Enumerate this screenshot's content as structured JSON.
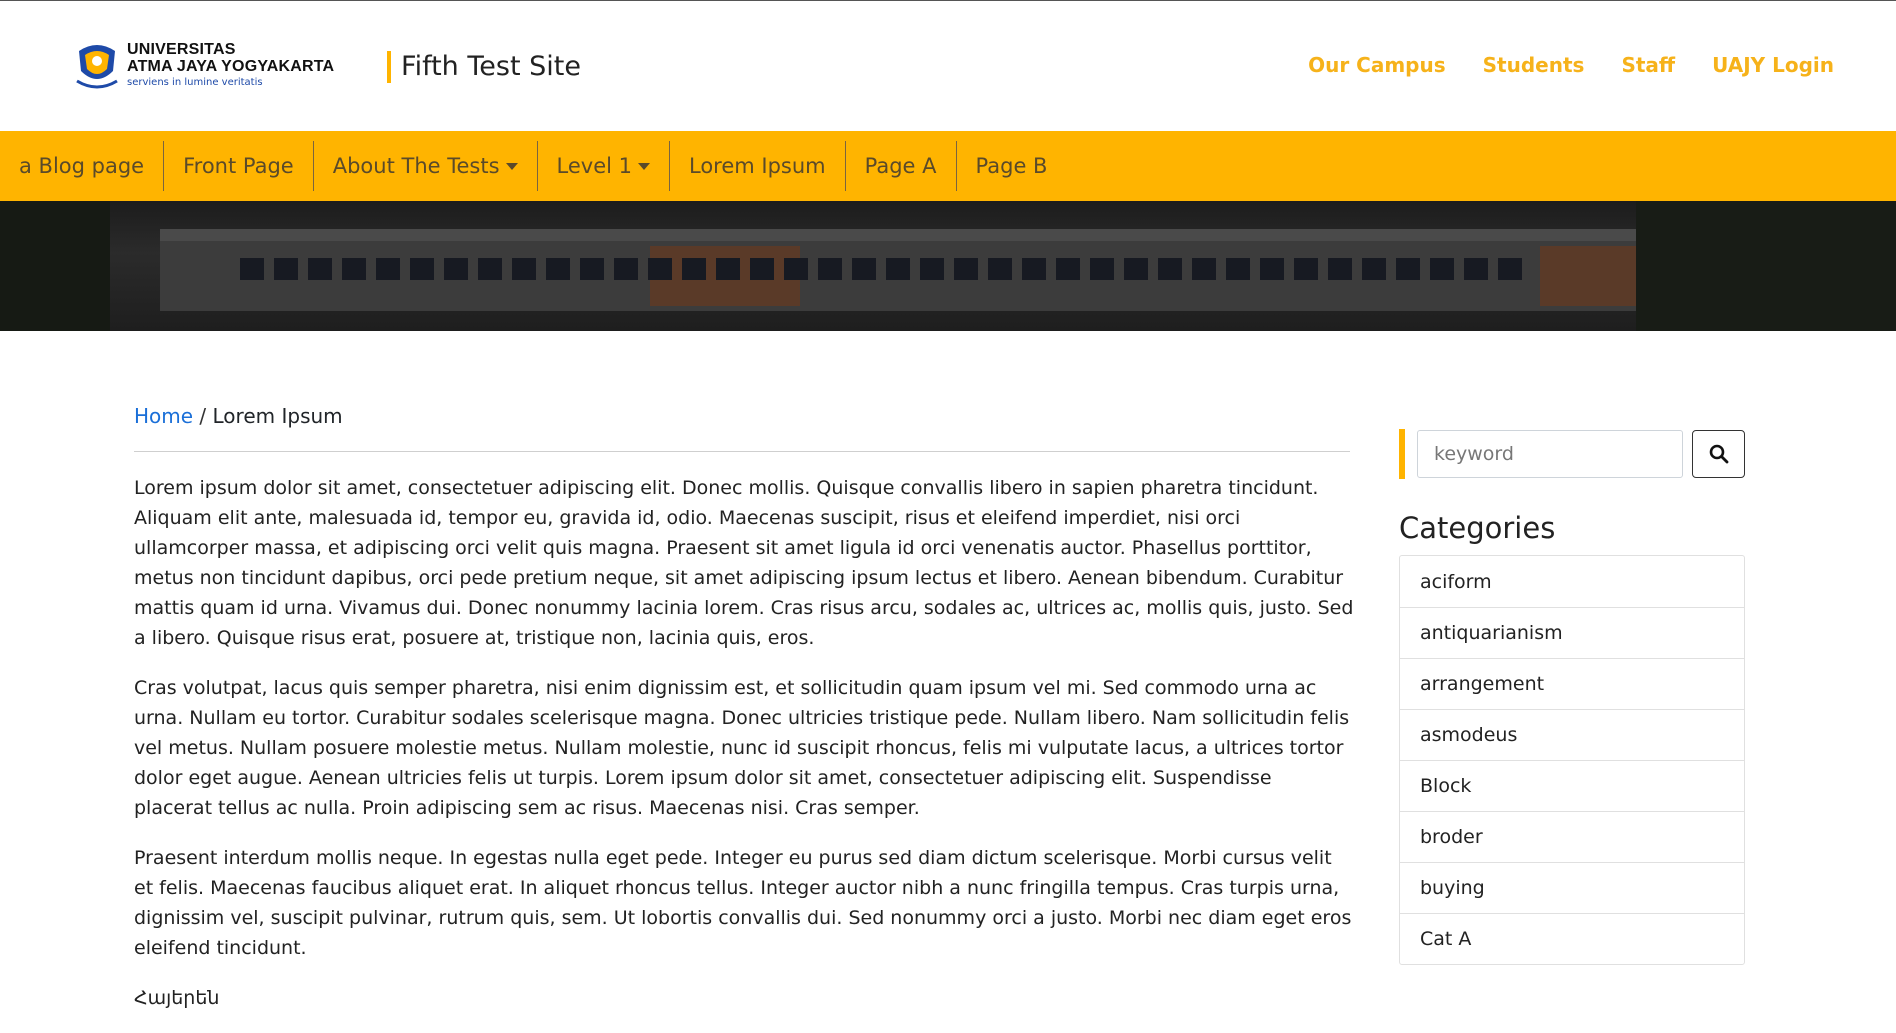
{
  "header": {
    "logo": {
      "line1": "UNIVERSITAS",
      "line2": "ATMA JAYA YOGYAKARTA",
      "tagline": "serviens in lumine veritatis"
    },
    "site_name": "Fifth Test Site",
    "top_links": [
      "Our Campus",
      "Students",
      "Staff",
      "UAJY Login"
    ],
    "accent_color": "#ffb400",
    "link_color": "#f6b21a"
  },
  "nav": {
    "items": [
      {
        "label": "a Blog page",
        "dropdown": false
      },
      {
        "label": "Front Page",
        "dropdown": false
      },
      {
        "label": "About The Tests",
        "dropdown": true
      },
      {
        "label": "Level 1",
        "dropdown": true
      },
      {
        "label": "Lorem Ipsum",
        "dropdown": false
      },
      {
        "label": "Page A",
        "dropdown": false
      },
      {
        "label": "Page B",
        "dropdown": false
      }
    ]
  },
  "breadcrumb": {
    "home": "Home",
    "separator": " / ",
    "current": "Lorem Ipsum"
  },
  "content": {
    "paragraphs": [
      "Lorem ipsum dolor sit amet, consectetuer adipiscing elit. Donec mollis. Quisque convallis libero in sapien pharetra tincidunt. Aliquam elit ante, malesuada id, tempor eu, gravida id, odio. Maecenas suscipit, risus et eleifend imperdiet, nisi orci ullamcorper massa, et adipiscing orci velit quis magna. Praesent sit amet ligula id orci venenatis auctor. Phasellus porttitor, metus non tincidunt dapibus, orci pede pretium neque, sit amet adipiscing ipsum lectus et libero. Aenean bibendum. Curabitur mattis quam id urna. Vivamus dui. Donec nonummy lacinia lorem. Cras risus arcu, sodales ac, ultrices ac, mollis quis, justo. Sed a libero. Quisque risus erat, posuere at, tristique non, lacinia quis, eros.",
      "Cras volutpat, lacus quis semper pharetra, nisi enim dignissim est, et sollicitudin quam ipsum vel mi. Sed commodo urna ac urna. Nullam eu tortor. Curabitur sodales scelerisque magna. Donec ultricies tristique pede. Nullam libero. Nam sollicitudin felis vel metus. Nullam posuere molestie metus. Nullam molestie, nunc id suscipit rhoncus, felis mi vulputate lacus, a ultrices tortor dolor eget augue. Aenean ultricies felis ut turpis. Lorem ipsum dolor sit amet, consectetuer adipiscing elit. Suspendisse placerat tellus ac nulla. Proin adipiscing sem ac risus. Maecenas nisi. Cras semper.",
      "Praesent interdum mollis neque. In egestas nulla eget pede. Integer eu purus sed diam dictum scelerisque. Morbi cursus velit et felis. Maecenas faucibus aliquet erat. In aliquet rhoncus tellus. Integer auctor nibh a nunc fringilla tempus. Cras turpis urna, dignissim vel, suscipit pulvinar, rutrum quis, sem. Ut lobortis convallis dui. Sed nonummy orci a justo. Morbi nec diam eget eros eleifend tincidunt.",
      "Հայերեն"
    ]
  },
  "sidebar": {
    "search": {
      "placeholder": "keyword",
      "value": "",
      "button_icon": "search-icon"
    },
    "categories_title": "Categories",
    "categories": [
      "aciform",
      "antiquarianism",
      "arrangement",
      "asmodeus",
      "Block",
      "broder",
      "buying",
      "Cat A"
    ]
  }
}
